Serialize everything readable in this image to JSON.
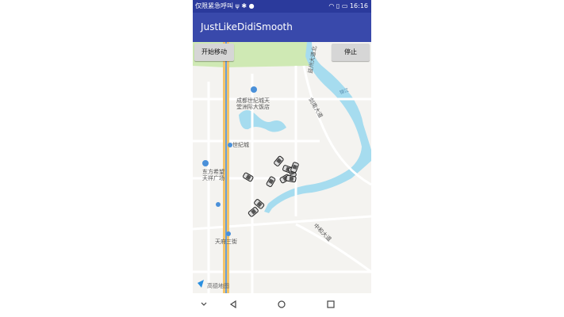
{
  "status_bar": {
    "carrier": "仅限紧急呼叫",
    "time": "16:16",
    "icons": [
      "usb-icon",
      "debug-icon",
      "alert-icon",
      "wifi-icon",
      "sim-icon",
      "battery-icon"
    ]
  },
  "app_bar": {
    "title": "JustLikeDidiSmooth"
  },
  "buttons": {
    "start_label": "开始移动",
    "stop_label": "停止"
  },
  "map": {
    "labels": {
      "poi_hotel": [
        "成都世纪城天",
        "堂洲际大饭店"
      ],
      "century_city": "世纪城",
      "square": [
        "东方希望",
        "天祥广场"
      ],
      "tianfu_3rd": "天府三街",
      "rd_north": "益州大道北",
      "rd_east": "剑南大道",
      "river": "锦江",
      "rd_zhonghe": "中和大道"
    },
    "logo": "高德地图",
    "colors": {
      "land": "#f4f3f0",
      "green": "#cfe9b4",
      "water": "#a6dcef",
      "road": "#ffffff",
      "highway": "#f3c46a",
      "poi": "#4a90d9"
    }
  },
  "cars": {
    "count": 10
  },
  "nav_bar": {
    "icons": [
      "chevron-down-icon",
      "back-icon",
      "home-icon",
      "recents-icon"
    ]
  }
}
